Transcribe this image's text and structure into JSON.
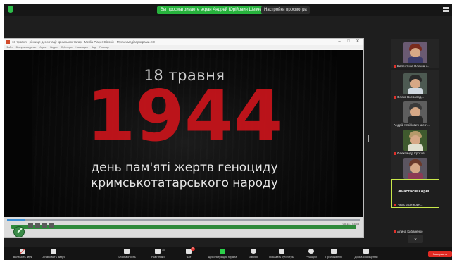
{
  "app": {
    "share_banner": "Вы просматриваете экран Андрей Юрійович Шевченко",
    "view_options": "Настройки просмотра",
    "view_options_caret": "∨"
  },
  "shared_window": {
    "title": "18 травня - річниця депортації кримських татар - Media Player Classic - Мультимедіапрограми.ХО",
    "menu": [
      "Файл",
      "Воспроизведение",
      "Аудио",
      "Видео",
      "Субтитры",
      "Навигация",
      "Вид",
      "Помощь"
    ],
    "controls": [
      "–",
      "□",
      "✕"
    ],
    "video": {
      "date": "18 травня",
      "year": "1944",
      "line1": "день пам'яті жертв геноциду",
      "line2": "кримськотатарського народу"
    },
    "player": {
      "progress": 0.05,
      "caption": "00:14 / 03:58"
    }
  },
  "participants": [
    {
      "name": "Валентина Олексан...",
      "muted": true
    },
    {
      "name": "Олекс Всеволод...",
      "muted": true
    },
    {
      "name": "Андрій Юрійович Шевч...",
      "muted": false
    },
    {
      "name": "Олександр Кротов",
      "muted": true
    },
    {
      "name": "Тетяна Іваній",
      "muted": true
    },
    {
      "name": "Анастасія Корн...",
      "muted": true,
      "active": true,
      "big_name": "Анастасія Корні..."
    },
    {
      "name": "Алина Кабаненко",
      "muted": true
    }
  ],
  "toolbar": {
    "items": [
      {
        "label": "Включить звук",
        "icon": "microphone-muted-icon"
      },
      {
        "label": "Остановить видео",
        "icon": "camera-icon"
      },
      {
        "label": "Безопасность",
        "icon": "shield-icon"
      },
      {
        "label": "Участники",
        "icon": "participants-icon",
        "count": "10"
      },
      {
        "label": "Чат",
        "icon": "chat-icon",
        "badge": "70"
      },
      {
        "label": "Демонстрация экрана",
        "icon": "share-screen-icon"
      },
      {
        "label": "Запись",
        "icon": "record-icon"
      },
      {
        "label": "Показать субтитры",
        "icon": "subtitles-icon"
      },
      {
        "label": "Реакции",
        "icon": "reactions-icon"
      },
      {
        "label": "Приложения",
        "icon": "apps-icon"
      },
      {
        "label": "Доска сообщений",
        "icon": "whiteboard-icon"
      }
    ],
    "end_label": "Завершить"
  },
  "colors": {
    "zoom_bg": "#1e1e1e",
    "share_green": "#27b33d",
    "year_red": "#c8141b",
    "end_red": "#e02a23",
    "active_border": "#c9e84a"
  }
}
